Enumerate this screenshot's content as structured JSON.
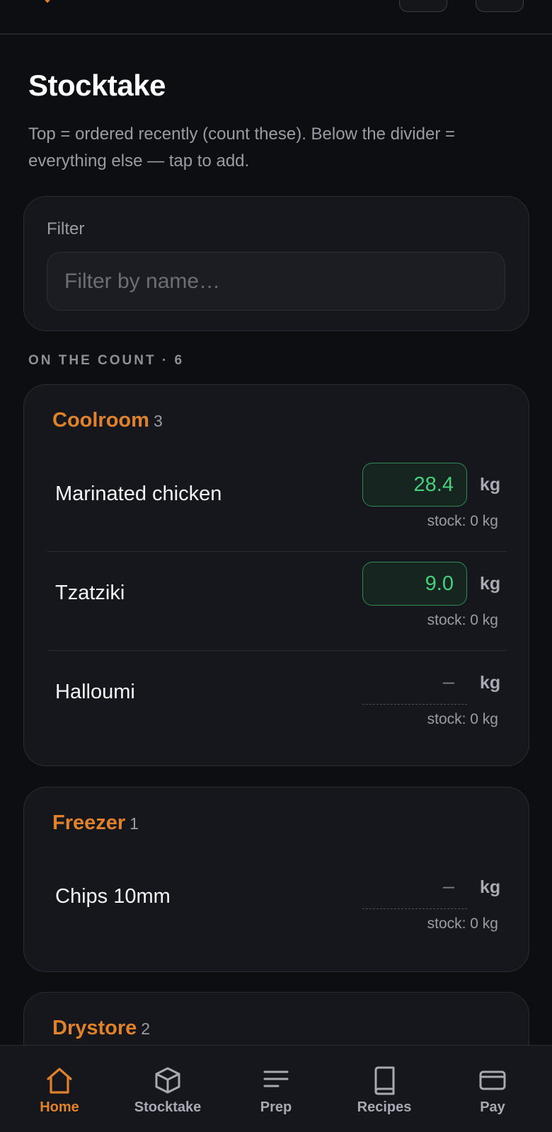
{
  "page": {
    "title": "Stocktake",
    "description": "Top = ordered recently (count these). Below the divider = everything else — tap to add."
  },
  "filter": {
    "label": "Filter",
    "placeholder": "Filter by name…",
    "value": ""
  },
  "section": {
    "heading": "ON THE COUNT · 6"
  },
  "groups": [
    {
      "name": "Coolroom",
      "count": "3",
      "items": [
        {
          "name": "Marinated chicken",
          "qty": "28.4",
          "unit": "kg",
          "stock": "stock: 0 kg"
        },
        {
          "name": "Tzatziki",
          "qty": "9.0",
          "unit": "kg",
          "stock": "stock: 0 kg"
        },
        {
          "name": "Halloumi",
          "qty": "–",
          "unit": "kg",
          "stock": "stock: 0 kg"
        }
      ]
    },
    {
      "name": "Freezer",
      "count": "1",
      "items": [
        {
          "name": "Chips 10mm",
          "qty": "–",
          "unit": "kg",
          "stock": "stock: 0 kg"
        }
      ]
    },
    {
      "name": "Drystore",
      "count": "2",
      "items": []
    }
  ],
  "nav": {
    "items": [
      {
        "label": "Home",
        "icon": "home-icon",
        "active": true
      },
      {
        "label": "Stocktake",
        "icon": "box-icon",
        "active": false
      },
      {
        "label": "Prep",
        "icon": "list-icon",
        "active": false
      },
      {
        "label": "Recipes",
        "icon": "book-icon",
        "active": false
      },
      {
        "label": "Pay",
        "icon": "card-icon",
        "active": false
      }
    ]
  },
  "colors": {
    "accent": "#e0812c",
    "filled_qty": "#46d07c",
    "background": "#0d0e12",
    "card": "#16171c"
  }
}
